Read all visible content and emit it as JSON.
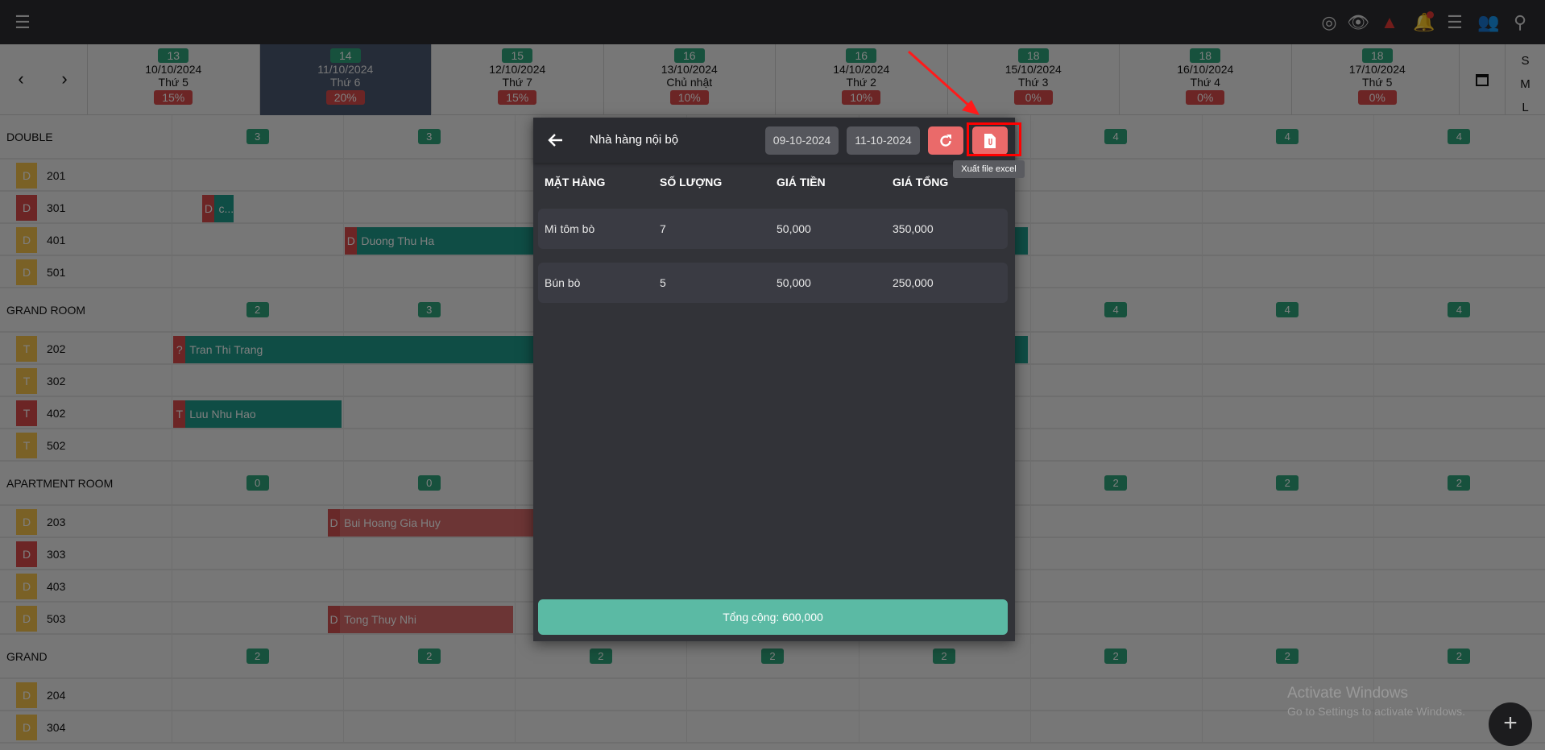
{
  "topbar": {
    "menu_icon": "hamburger-icon",
    "icons": [
      "fingerprint-icon",
      "eye-icon",
      "warning-icon",
      "bell-icon",
      "list-icon",
      "add-user-icon",
      "search-icon"
    ],
    "warning_color": "#e53935"
  },
  "header": {
    "days": [
      {
        "count": "13",
        "date": "10/10/2024",
        "weekday": "Thứ 5",
        "pct": "15%"
      },
      {
        "count": "14",
        "date": "11/10/2024",
        "weekday": "Thứ 6",
        "pct": "20%",
        "selected": true
      },
      {
        "count": "15",
        "date": "12/10/2024",
        "weekday": "Thứ 7",
        "pct": "15%"
      },
      {
        "count": "16",
        "date": "13/10/2024",
        "weekday": "Chủ nhật",
        "pct": "10%"
      },
      {
        "count": "16",
        "date": "14/10/2024",
        "weekday": "Thứ 2",
        "pct": "10%"
      },
      {
        "count": "18",
        "date": "15/10/2024",
        "weekday": "Thứ 3",
        "pct": "0%"
      },
      {
        "count": "18",
        "date": "16/10/2024",
        "weekday": "Thứ 4",
        "pct": "0%"
      },
      {
        "count": "18",
        "date": "17/10/2024",
        "weekday": "Thứ 5",
        "pct": "0%"
      }
    ],
    "sizes": [
      "S",
      "M",
      "L"
    ]
  },
  "groups": [
    {
      "name": "DOUBLE",
      "counts": [
        "3",
        "3",
        null,
        null,
        null,
        "4",
        "4",
        "4"
      ],
      "rooms": [
        {
          "tag": "D",
          "num": "201",
          "color": "#f5c24c"
        },
        {
          "tag": "D",
          "num": "301",
          "color": "#d94a4a",
          "booking": {
            "tag": "D",
            "name": "c...",
            "start": 0.18,
            "end": 0.36,
            "red": false
          }
        },
        {
          "tag": "D",
          "num": "401",
          "color": "#f5c24c",
          "booking": {
            "tag": "D",
            "name": "Duong Thu Ha",
            "start": 1.01,
            "end": 4.99,
            "red": false
          }
        },
        {
          "tag": "D",
          "num": "501",
          "color": "#f5c24c"
        }
      ]
    },
    {
      "name": "GRAND ROOM",
      "counts": [
        "2",
        "3",
        null,
        null,
        null,
        "4",
        "4",
        "4"
      ],
      "rooms": [
        {
          "tag": "T",
          "num": "202",
          "color": "#f5c24c",
          "booking": {
            "tag": "?",
            "name": "Tran Thi Trang",
            "start": 0.01,
            "end": 4.99,
            "red": false
          }
        },
        {
          "tag": "T",
          "num": "302",
          "color": "#f5c24c"
        },
        {
          "tag": "T",
          "num": "402",
          "color": "#d94a4a",
          "booking": {
            "tag": "T",
            "name": "Luu Nhu Hao",
            "start": 0.01,
            "end": 0.99,
            "red": false
          }
        },
        {
          "tag": "T",
          "num": "502",
          "color": "#f5c24c"
        }
      ]
    },
    {
      "name": "APARTMENT ROOM",
      "counts": [
        "0",
        "0",
        null,
        null,
        null,
        "2",
        "2",
        "2"
      ],
      "rooms": [
        {
          "tag": "D",
          "num": "203",
          "color": "#f5c24c",
          "booking": {
            "tag": "D",
            "name": "Bui Hoang Gia Huy",
            "start": 0.91,
            "end": 2.3,
            "red": true
          }
        },
        {
          "tag": "D",
          "num": "303",
          "color": "#d94a4a"
        },
        {
          "tag": "D",
          "num": "403",
          "color": "#f5c24c"
        },
        {
          "tag": "D",
          "num": "503",
          "color": "#f5c24c",
          "booking": {
            "tag": "D",
            "name": "Tong Thuy Nhi",
            "start": 0.91,
            "end": 1.99,
            "red": true
          }
        }
      ]
    },
    {
      "name": "GRAND",
      "counts": [
        "2",
        "2",
        "2",
        "2",
        "2",
        "2",
        "2",
        "2"
      ],
      "rooms": [
        {
          "tag": "D",
          "num": "204",
          "color": "#f5c24c"
        },
        {
          "tag": "D",
          "num": "304",
          "color": "#f5c24c"
        }
      ]
    }
  ],
  "modal": {
    "title": "Nhà hàng nội bộ",
    "date_from": "09-10-2024",
    "date_to": "11-10-2024",
    "export_tooltip": "Xuất file excel",
    "columns": [
      "MẶT HÀNG",
      "SỐ LƯỢNG",
      "GIÁ TIỀN",
      "GIÁ TỔNG"
    ],
    "rows": [
      [
        "Mì tôm bò",
        "7",
        "50,000",
        "350,000"
      ],
      [
        "Bún bò",
        "5",
        "50,000",
        "250,000"
      ]
    ],
    "total": "Tổng cộng: 600,000",
    "accent": "#5bbaa4",
    "button_color": "#ea6a6a"
  },
  "watermark": {
    "title": "Activate Windows",
    "subtitle": "Go to Settings to activate Windows."
  },
  "fab": {
    "label": "+"
  }
}
